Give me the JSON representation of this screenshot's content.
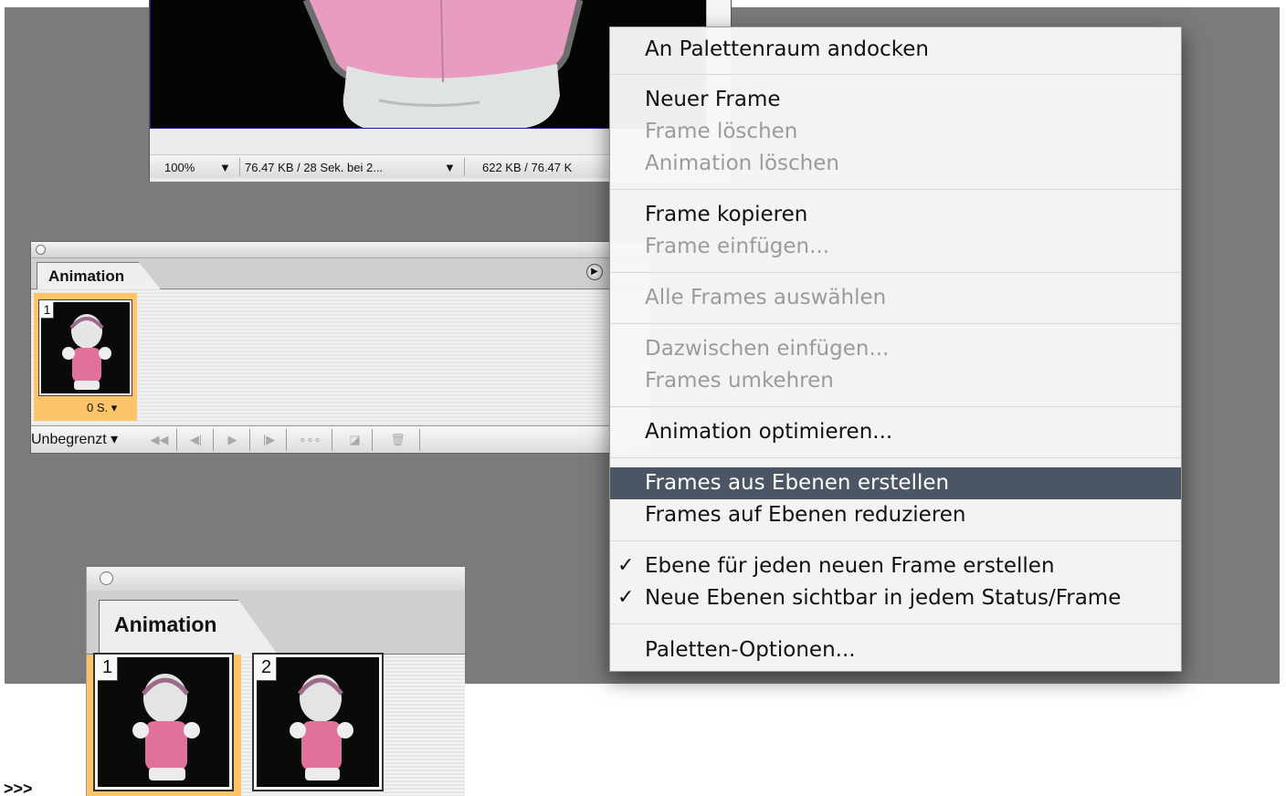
{
  "document": {
    "zoom": "100%",
    "file_info": "76.47 KB / 28 Sek. bei 2...",
    "size_info": "622 KB / 76.47 K"
  },
  "palette": {
    "tab_label": "Animation",
    "frames": [
      {
        "number": "1",
        "delay": "0 S."
      }
    ],
    "loop_option": "Unbegrenzt",
    "toolbar_icons": [
      "first-frame-icon",
      "previous-frame-icon",
      "play-icon",
      "next-frame-icon",
      "tween-icon",
      "duplicate-frame-icon",
      "delete-frame-icon"
    ]
  },
  "context_menu": {
    "items": [
      {
        "label": "An Palettenraum andocken",
        "enabled": true
      },
      {
        "label": "Neuer Frame",
        "enabled": true
      },
      {
        "label": "Frame löschen",
        "enabled": false
      },
      {
        "label": "Animation löschen",
        "enabled": false
      },
      {
        "label": "Frame kopieren",
        "enabled": true
      },
      {
        "label": "Frame einfügen...",
        "enabled": false
      },
      {
        "label": "Alle Frames auswählen",
        "enabled": false
      },
      {
        "label": "Dazwischen einfügen...",
        "enabled": false
      },
      {
        "label": "Frames umkehren",
        "enabled": false
      },
      {
        "label": "Animation optimieren...",
        "enabled": true
      },
      {
        "label": "Frames aus Ebenen erstellen",
        "enabled": true,
        "highlighted": true
      },
      {
        "label": "Frames auf Ebenen reduzieren",
        "enabled": true
      },
      {
        "label": "Ebene für jeden neuen Frame erstellen",
        "enabled": true,
        "checked": true
      },
      {
        "label": "Neue Ebenen sichtbar in jedem Status/Frame",
        "enabled": true,
        "checked": true
      },
      {
        "label": "Paletten-Optionen...",
        "enabled": true
      }
    ],
    "highlight_color": "#4b5563"
  },
  "result_palette": {
    "tab_label": "Animation",
    "frames": [
      {
        "number": "1",
        "selected": true
      },
      {
        "number": "2",
        "selected": false
      }
    ]
  },
  "arrow_text": ">>>",
  "colors": {
    "workspace": "#7b7b7b",
    "selected_frame": "#fdc46a"
  }
}
